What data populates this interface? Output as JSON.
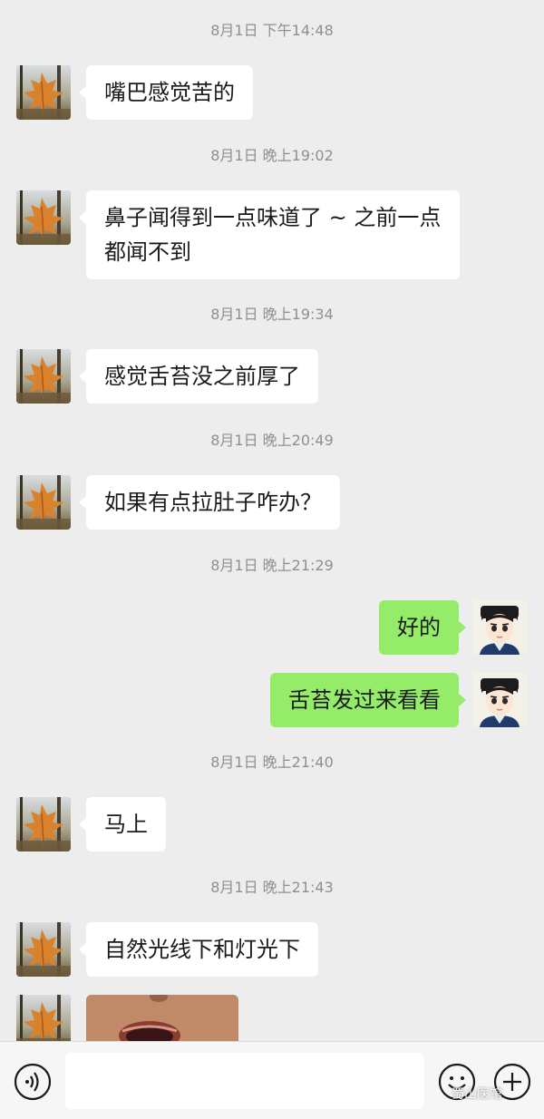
{
  "messages": [
    {
      "timestamp": "8月1日 下午14:48",
      "sender": "other",
      "text": "嘴巴感觉苦的"
    },
    {
      "timestamp": "8月1日 晚上19:02",
      "sender": "other",
      "text": "鼻子闻得到一点味道了 ~ 之前一点都闻不到"
    },
    {
      "timestamp": "8月1日 晚上19:34",
      "sender": "other",
      "text": "感觉舌苔没之前厚了"
    },
    {
      "timestamp": "8月1日 晚上20:49",
      "sender": "other",
      "text": "如果有点拉肚子咋办？"
    },
    {
      "timestamp": "8月1日 晚上21:29",
      "sender": "me",
      "text": "好的"
    },
    {
      "sender": "me",
      "text": "舌苔发过来看看"
    },
    {
      "timestamp": "8月1日 晚上21:40",
      "sender": "other",
      "text": "马上"
    },
    {
      "timestamp": "8月1日 晚上21:43",
      "sender": "other",
      "text": "自然光线下和灯光下"
    },
    {
      "sender": "other",
      "type": "image"
    }
  ],
  "input_bar": {
    "left_icon": "voice-icon",
    "right_icons": [
      "emoji-icon",
      "plus-icon"
    ],
    "input_value": ""
  },
  "watermark": "蜀山医馆",
  "colors": {
    "background": "#ededed",
    "incoming_bubble": "#ffffff",
    "outgoing_bubble": "#95ec69",
    "timestamp": "#8f8f8f"
  }
}
